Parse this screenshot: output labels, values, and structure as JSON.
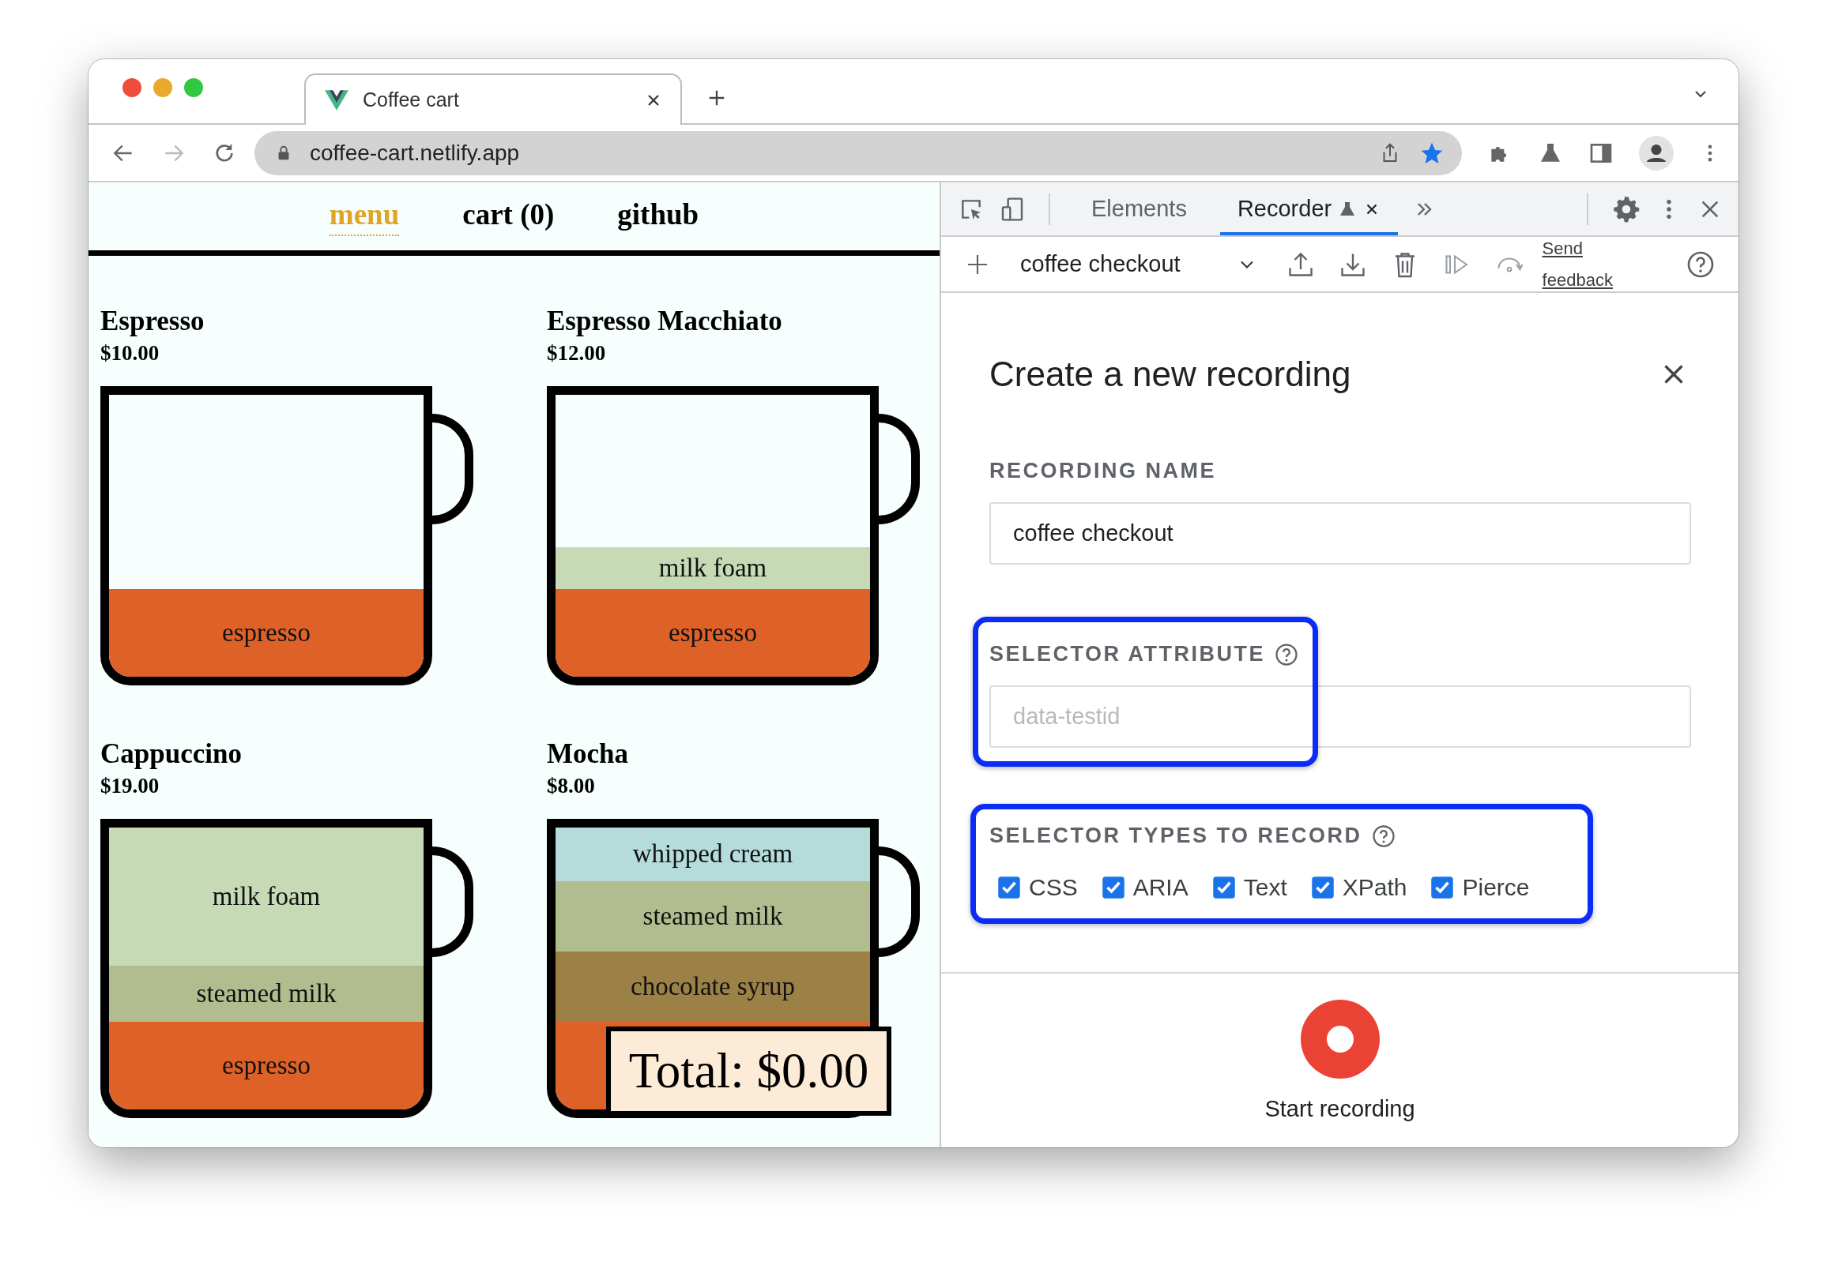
{
  "browser": {
    "tab": {
      "title": "Coffee cart"
    },
    "address": "coffee-cart.netlify.app"
  },
  "site": {
    "nav": [
      {
        "label": "menu",
        "selected": true
      },
      {
        "label": "cart (0)",
        "selected": false
      },
      {
        "label": "github",
        "selected": false
      }
    ],
    "coffees": [
      {
        "name": "Espresso",
        "price": "$10.00",
        "layers": [
          {
            "label": "espresso",
            "color": "#de6128"
          }
        ]
      },
      {
        "name": "Espresso Macchiato",
        "price": "$12.00",
        "layers": [
          {
            "label": "milk foam",
            "color": "#c6dab5"
          },
          {
            "label": "espresso",
            "color": "#de6128"
          }
        ]
      },
      {
        "name": "Cappuccino",
        "price": "$19.00",
        "layers": [
          {
            "label": "milk foam",
            "color": "#c6dab5"
          },
          {
            "label": "steamed milk",
            "color": "#b2bd8f"
          },
          {
            "label": "espresso",
            "color": "#de6128"
          }
        ]
      },
      {
        "name": "Mocha",
        "price": "$8.00",
        "layers": [
          {
            "label": "whipped cream",
            "color": "#b5dcdb"
          },
          {
            "label": "steamed milk",
            "color": "#b2bd8f"
          },
          {
            "label": "chocolate syrup",
            "color": "#9c8147"
          },
          {
            "color": "#de6128"
          }
        ]
      }
    ],
    "total": "Total: $0.00"
  },
  "devtools": {
    "tabs": [
      {
        "label": "Elements",
        "selected": false
      },
      {
        "label": "Recorder",
        "selected": true
      }
    ],
    "recording": "coffee checkout",
    "feedback": "Send feedback",
    "dialog": {
      "title": "Create a new recording",
      "name_label": "RECORDING NAME",
      "name_value": "coffee checkout",
      "attribute_label": "SELECTOR ATTRIBUTE",
      "attribute_placeholder": "data-testid",
      "types_label": "SELECTOR TYPES TO RECORD",
      "types": [
        {
          "label": "CSS",
          "checked": true
        },
        {
          "label": "ARIA",
          "checked": true
        },
        {
          "label": "Text",
          "checked": true
        },
        {
          "label": "XPath",
          "checked": true
        },
        {
          "label": "Pierce",
          "checked": true
        }
      ],
      "start": "Start recording"
    }
  }
}
